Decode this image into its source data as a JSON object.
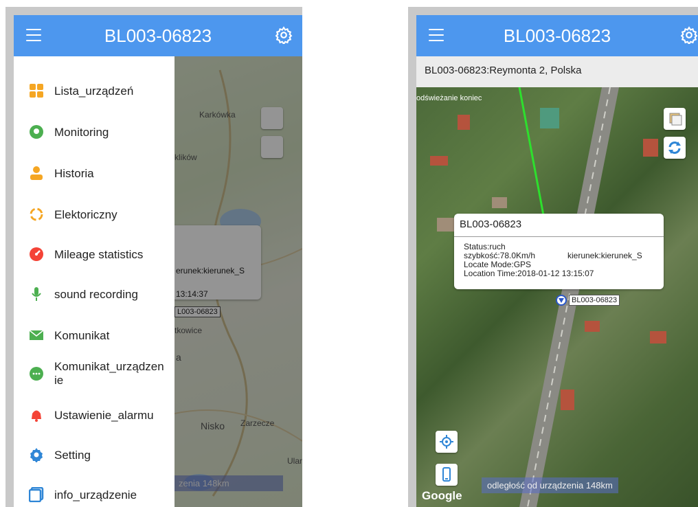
{
  "device_title": "BL003-06823",
  "left": {
    "map_labels": {
      "karkowka": "Karkówka",
      "klikow": "klików",
      "nisko": "Nisko",
      "zarzecze": "Zarzecze",
      "tkowice": "tkowice",
      "ulanow": "Ulano",
      "a": "a"
    },
    "popup": {
      "direction": "erunek:kierunek_S",
      "time": "13:14:37",
      "tag": "L003-06823"
    },
    "distance": "zenia 148km",
    "menu": [
      {
        "label": "Lista_urządzeń",
        "icon": "grid-icon",
        "color": "#f5a623"
      },
      {
        "label": "Monitoring",
        "icon": "location-pin-icon",
        "color": "#4caf50"
      },
      {
        "label": "Historia",
        "icon": "person-history-icon",
        "color": "#f5a623"
      },
      {
        "label": "Elektoriczny",
        "icon": "circle-fence-icon",
        "color": "#f5a623"
      },
      {
        "label": "Mileage statistics",
        "icon": "gauge-icon",
        "color": "#f44336"
      },
      {
        "label": "sound recording",
        "icon": "microphone-icon",
        "color": "#4caf50"
      },
      {
        "label": "Komunikat",
        "icon": "mail-icon",
        "color": "#4caf50"
      },
      {
        "label": "Komunikat_urządzen\nie",
        "icon": "chat-bubble-icon",
        "color": "#4caf50"
      },
      {
        "label": "Ustawienie_alarmu",
        "icon": "bell-icon",
        "color": "#f44336"
      },
      {
        "label": "Setting",
        "icon": "gear-icon",
        "color": "#2f86d6"
      },
      {
        "label": "info_urządzenie",
        "icon": "device-info-icon",
        "color": "#2f86d6"
      }
    ]
  },
  "right": {
    "address": "BL003-06823:Reymonta 2, Polska",
    "refresh_notice": "odświeżanie koniec",
    "popup": {
      "title": "BL003-06823",
      "status": "Status:ruch",
      "speed": "szybkość:78.0Km/h",
      "direction": "kierunek:kierunek_S",
      "mode": "Locate Mode:GPS",
      "time": "Location Time:2018-01-12 13:15:07"
    },
    "marker_label": "BL003-06823",
    "distance": "odległość od urządzenia 148km",
    "google": "Google"
  }
}
